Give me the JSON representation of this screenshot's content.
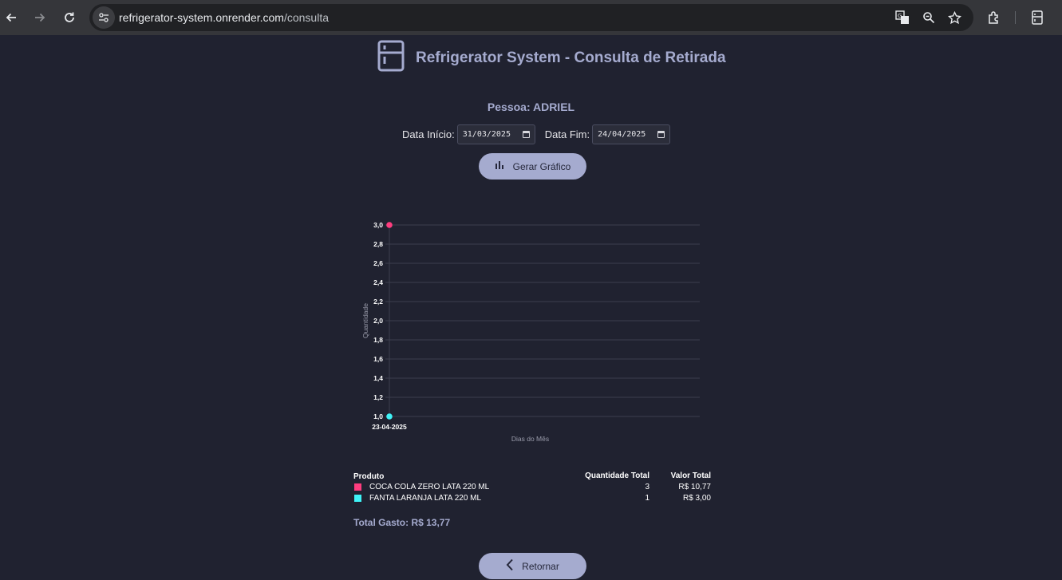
{
  "browser": {
    "url_host": "refrigerator-system.onrender.com",
    "url_path": "/consulta"
  },
  "header": {
    "title": "Refrigerator System - Consulta de Retirada"
  },
  "person": {
    "label": "Pessoa: ADRIEL"
  },
  "filters": {
    "start_label": "Data Início:",
    "start_value": "31/03/2025",
    "end_label": "Data Fim:",
    "end_value": "24/04/2025"
  },
  "buttons": {
    "generate": "Gerar Gráfico",
    "back": "Retornar"
  },
  "colors": {
    "accent": "#a5abcf",
    "background": "#202230",
    "series_coca": "#ff3d7f",
    "series_fanta": "#3ff3f7"
  },
  "chart_data": {
    "type": "scatter",
    "xlabel": "Dias do Mês",
    "ylabel": "Quantidade",
    "ylim": [
      1.0,
      3.0
    ],
    "yticks": [
      "1,0",
      "1,2",
      "1,4",
      "1,6",
      "1,8",
      "2,0",
      "2,2",
      "2,4",
      "2,6",
      "2,8",
      "3,0"
    ],
    "categories": [
      "23-04-2025"
    ],
    "grid": true,
    "series": [
      {
        "name": "COCA COLA ZERO LATA 220 ML",
        "color": "#ff3d7f",
        "values": [
          3
        ]
      },
      {
        "name": "FANTA LARANJA LATA 220 ML",
        "color": "#3ff3f7",
        "values": [
          1
        ]
      }
    ]
  },
  "table": {
    "headers": {
      "product": "Produto",
      "quantity": "Quantidade Total",
      "value": "Valor Total"
    },
    "rows": [
      {
        "product": "COCA COLA ZERO LATA 220 ML",
        "quantity": "3",
        "value": "R$ 10,77",
        "color": "#ff3d7f"
      },
      {
        "product": "FANTA LARANJA LATA 220 ML",
        "quantity": "1",
        "value": "R$ 3,00",
        "color": "#3ff3f7"
      }
    ]
  },
  "total": "Total Gasto: R$ 13,77"
}
